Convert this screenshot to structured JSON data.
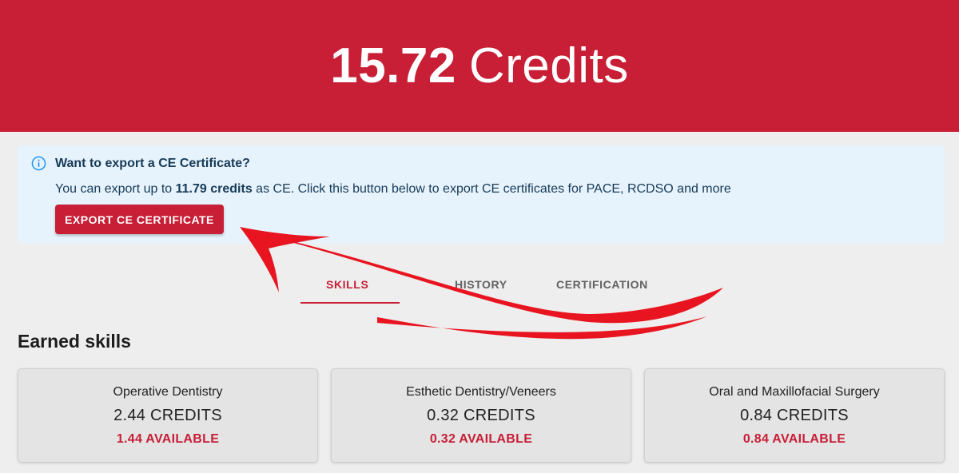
{
  "hero": {
    "credits_value": "15.72",
    "credits_unit": "Credits"
  },
  "alert": {
    "icon": "info-icon",
    "title": "Want to export a CE Certificate?",
    "body_prefix": "You can export up to ",
    "body_highlight": "11.79 credits",
    "body_suffix": " as CE. Click this button below to export CE certificates for PACE, RCDSO and more",
    "button_label": "EXPORT CE CERTIFICATE"
  },
  "tabs": [
    {
      "label": "SKILLS",
      "active": true
    },
    {
      "label": "HISTORY",
      "active": false
    },
    {
      "label": "CERTIFICATION",
      "active": false
    }
  ],
  "section_title": "Earned skills",
  "skills": [
    {
      "name": "Operative Dentistry",
      "credits": "2.44 CREDITS",
      "available": "1.44 AVAILABLE"
    },
    {
      "name": "Esthetic Dentistry/Veneers",
      "credits": "0.32 CREDITS",
      "available": "0.32 AVAILABLE"
    },
    {
      "name": "Oral and Maxillofacial Surgery",
      "credits": "0.84 CREDITS",
      "available": "0.84 AVAILABLE"
    }
  ],
  "colors": {
    "brand": "#c81e36",
    "alert_bg": "#e7f3fc",
    "alert_text": "#163a58",
    "page_bg": "#eeeeee",
    "annotation_arrow": "#e8141f"
  }
}
